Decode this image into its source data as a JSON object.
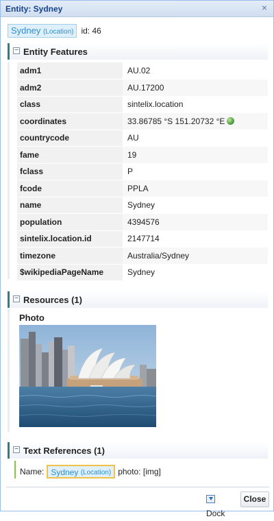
{
  "window": {
    "title": "Entity: Sydney",
    "close_glyph": "×"
  },
  "entity": {
    "name": "Sydney",
    "type": "(Location)",
    "id_text": "id: 46"
  },
  "features": {
    "header": "Entity Features",
    "toggle": "−",
    "rows": [
      {
        "key": "adm1",
        "value": "AU.02"
      },
      {
        "key": "adm2",
        "value": "AU.17200"
      },
      {
        "key": "class",
        "value": "sintelix.location"
      },
      {
        "key": "coordinates",
        "value": "33.86785 °S 151.20732 °E"
      },
      {
        "key": "countrycode",
        "value": "AU"
      },
      {
        "key": "fame",
        "value": "19"
      },
      {
        "key": "fclass",
        "value": "P"
      },
      {
        "key": "fcode",
        "value": "PPLA"
      },
      {
        "key": "name",
        "value": "Sydney"
      },
      {
        "key": "population",
        "value": "4394576"
      },
      {
        "key": "sintelix.location.id",
        "value": "2147714"
      },
      {
        "key": "timezone",
        "value": "Australia/Sydney"
      },
      {
        "key": "$wikipediaPageName",
        "value": "Sydney"
      }
    ]
  },
  "resources": {
    "header": "Resources (1)",
    "toggle": "−",
    "photo_label": "Photo"
  },
  "text_references": {
    "header": "Text References (1)",
    "toggle": "−",
    "prefix": "Name:",
    "entity_name": "Sydney",
    "entity_type": "(Location)",
    "suffix": "photo: [img]"
  },
  "footer": {
    "dock_label": "Dock",
    "close_label": "Close"
  },
  "colors": {
    "title_text": "#15428b",
    "chip_bg": "#dff0fb",
    "chip_text": "#2b8fd0",
    "section_accent": "#2e7f80",
    "ref_highlight": "#f1c24a",
    "ref_line": "#8cc63f"
  }
}
